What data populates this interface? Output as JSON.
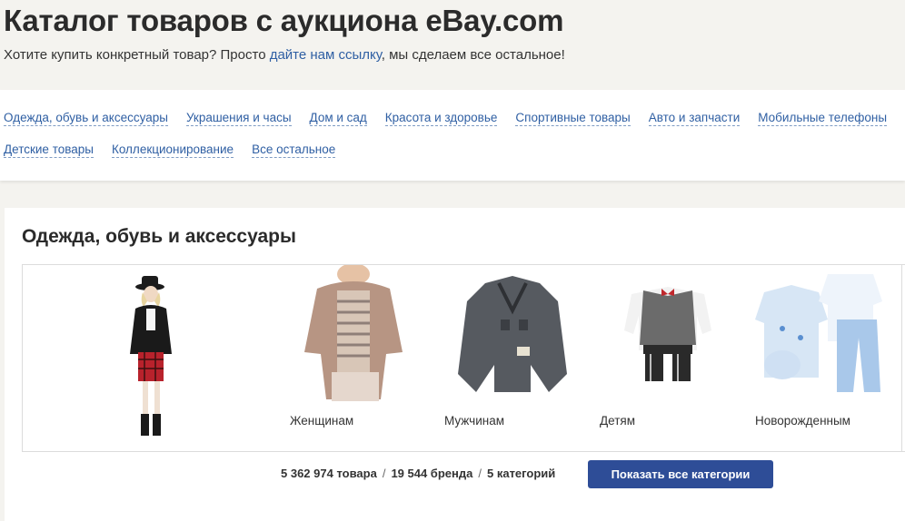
{
  "header": {
    "title": "Каталог товаров с аукциона eBay.com",
    "subtitle_before": "Хотите купить конкретный товар? Просто ",
    "subtitle_link": "дайте нам ссылку",
    "subtitle_after": ", мы сделаем все остальное!"
  },
  "nav": {
    "row1": [
      "Одежда, обувь и аксессуары",
      "Украшения и часы",
      "Дом и сад",
      "Красота и здоровье",
      "Спортивные товары",
      "Авто и запчасти",
      "Мобильные телефоны"
    ],
    "row2": [
      "Детские товары",
      "Коллекционирование",
      "Все остальное"
    ]
  },
  "section": {
    "title": "Одежда, обувь и аксессуары",
    "tiles": [
      {
        "label": "",
        "image": "woman-in-hat-outfit-photo"
      },
      {
        "label": "Женщинам",
        "image": "women-cardigan-photo"
      },
      {
        "label": "Мужчинам",
        "image": "men-jacket-photo"
      },
      {
        "label": "Детям",
        "image": "kids-suit-photo"
      },
      {
        "label": "Новорожденным",
        "image": "newborn-clothes-photo"
      }
    ],
    "stats": {
      "items": "5 362 974 товара",
      "brands": "19 544 бренда",
      "categories": "5 категорий",
      "separator": "/"
    },
    "show_all_label": "Показать все категории"
  },
  "colors": {
    "link": "#2f5fa3",
    "button": "#2e4d97",
    "background": "#f4f3ef"
  }
}
